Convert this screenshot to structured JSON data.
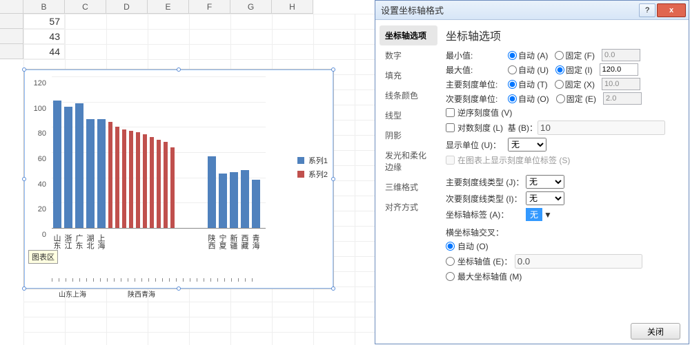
{
  "sheet": {
    "columns": [
      "",
      "B",
      "C",
      "D",
      "E",
      "F",
      "G",
      "H"
    ],
    "rows": [
      {
        "num": "",
        "val": "57"
      },
      {
        "num": "",
        "val": "43"
      },
      {
        "num": "",
        "val": "44"
      }
    ]
  },
  "chart_data": {
    "type": "bar",
    "ylim": [
      0,
      120
    ],
    "yticks": [
      0,
      20,
      40,
      60,
      80,
      100,
      120
    ],
    "series": [
      {
        "name": "系列1",
        "categories": [
          "山东",
          "浙江",
          "广东",
          "湖北",
          "上海",
          "",
          "",
          "",
          "",
          "",
          "",
          "",
          "",
          "",
          "陕西",
          "宁夏",
          "新疆",
          "西藏",
          "青海"
        ],
        "values": [
          101,
          96,
          99,
          86,
          86,
          null,
          null,
          null,
          null,
          null,
          null,
          null,
          null,
          null,
          57,
          43,
          44,
          46,
          38
        ]
      },
      {
        "name": "系列2",
        "categories": [
          "",
          "",
          "",
          "",
          "",
          "",
          "",
          "",
          "",
          ""
        ],
        "values": [
          84,
          80,
          78,
          77,
          76,
          74,
          72,
          70,
          68,
          64
        ]
      }
    ],
    "tooltip_label": "图表区",
    "secondary_axis_label_left": "山东上海",
    "secondary_axis_label_right": "陕西青海"
  },
  "dialog": {
    "title": "设置坐标轴格式",
    "btn_help": "?",
    "btn_close": "x",
    "nav": [
      "坐标轴选项",
      "数字",
      "填充",
      "线条颜色",
      "线型",
      "阴影",
      "发光和柔化边缘",
      "三维格式",
      "对齐方式"
    ],
    "nav_active": 0,
    "pane_title": "坐标轴选项",
    "auto_label": "自动",
    "fixed_label": "固定",
    "rows": [
      {
        "label": "最小值:",
        "mode": "auto",
        "auto_key": "(A)",
        "fixed_key": "(F)",
        "val": "0.0"
      },
      {
        "label": "最大值:",
        "mode": "fixed",
        "auto_key": "(U)",
        "fixed_key": "(I)",
        "val": "120.0"
      },
      {
        "label": "主要刻度单位:",
        "mode": "auto",
        "auto_key": "(T)",
        "fixed_key": "(X)",
        "val": "10.0"
      },
      {
        "label": "次要刻度单位:",
        "mode": "auto",
        "auto_key": "(O)",
        "fixed_key": "(E)",
        "val": "2.0"
      }
    ],
    "reverse_label": "逆序刻度值 (V)",
    "log_label": "对数刻度 (L)",
    "log_base_label": "基 (B)：",
    "log_base_val": "10",
    "disp_unit_label": "显示单位 (U)：",
    "disp_unit_val": "无",
    "disp_unit_chk": "在图表上显示刻度单位标签 (S)",
    "major_tick_label": "主要刻度线类型 (J)：",
    "major_tick_val": "无",
    "minor_tick_label": "次要刻度线类型 (I)：",
    "minor_tick_val": "无",
    "axis_label_label": "坐标轴标签 (A)：",
    "axis_label_val": "无",
    "cross_title": "横坐标轴交叉：",
    "cross_auto": "自动 (O)",
    "cross_value": "坐标轴值 (E)：",
    "cross_value_val": "0.0",
    "cross_max": "最大坐标轴值 (M)",
    "btn_close_footer": "关闭"
  }
}
